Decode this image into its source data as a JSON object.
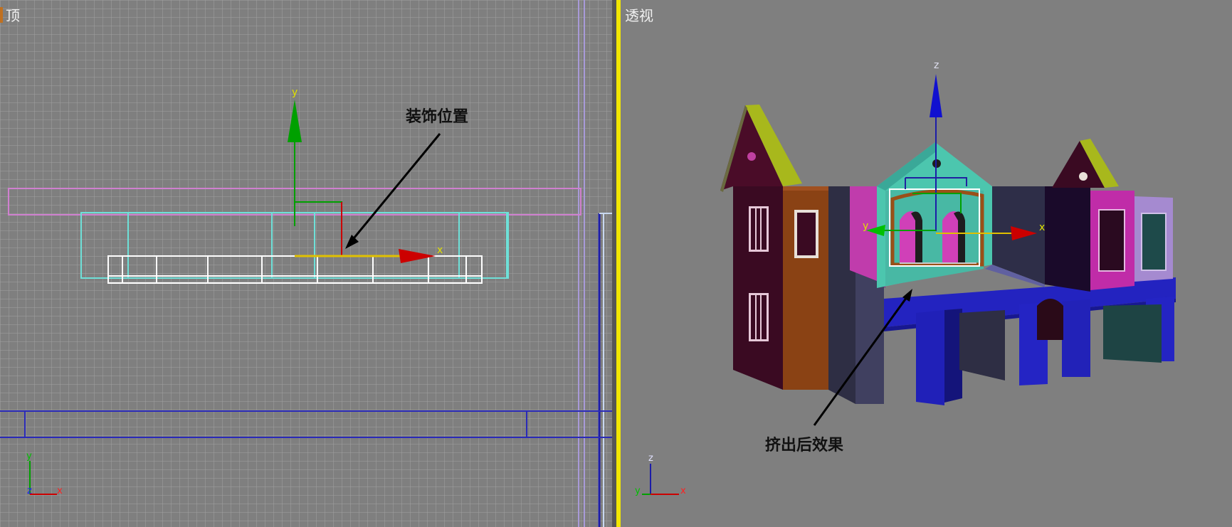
{
  "viewports": {
    "top": {
      "label": "顶",
      "annotation": "装饰位置",
      "axis_labels": {
        "gizmo_x": "x",
        "gizmo_y": "y",
        "corner_x": "x",
        "corner_y": "y",
        "corner_z": "z"
      }
    },
    "perspective": {
      "label": "透视",
      "annotation": "挤出后效果",
      "axis_labels": {
        "gizmo_x": "x",
        "gizmo_y": "y",
        "gizmo_z": "z",
        "corner_x": "x",
        "corner_y": "y",
        "corner_z": "z"
      }
    }
  },
  "icons": [
    "move-gizmo-icon",
    "axis-tripod-icon"
  ],
  "colors": {
    "viewport_bg": "#7f7f7f",
    "grid_minor": "#9a9a9a",
    "active_viewport_border": "#f2e600",
    "axis_x": "#cc0000",
    "axis_y": "#00a000",
    "axis_z": "#0000cc",
    "selection_cyan": "#6ee0d8",
    "blue_plane": "#1c1ca8",
    "teal_dormer": "#4cc6ae",
    "magenta_wall": "#c03cac",
    "brown_wall": "#8a4214",
    "dark_maroon": "#3a0a22",
    "lime_roof": "#a8b81c",
    "lilac_wall": "#a58ad0"
  }
}
